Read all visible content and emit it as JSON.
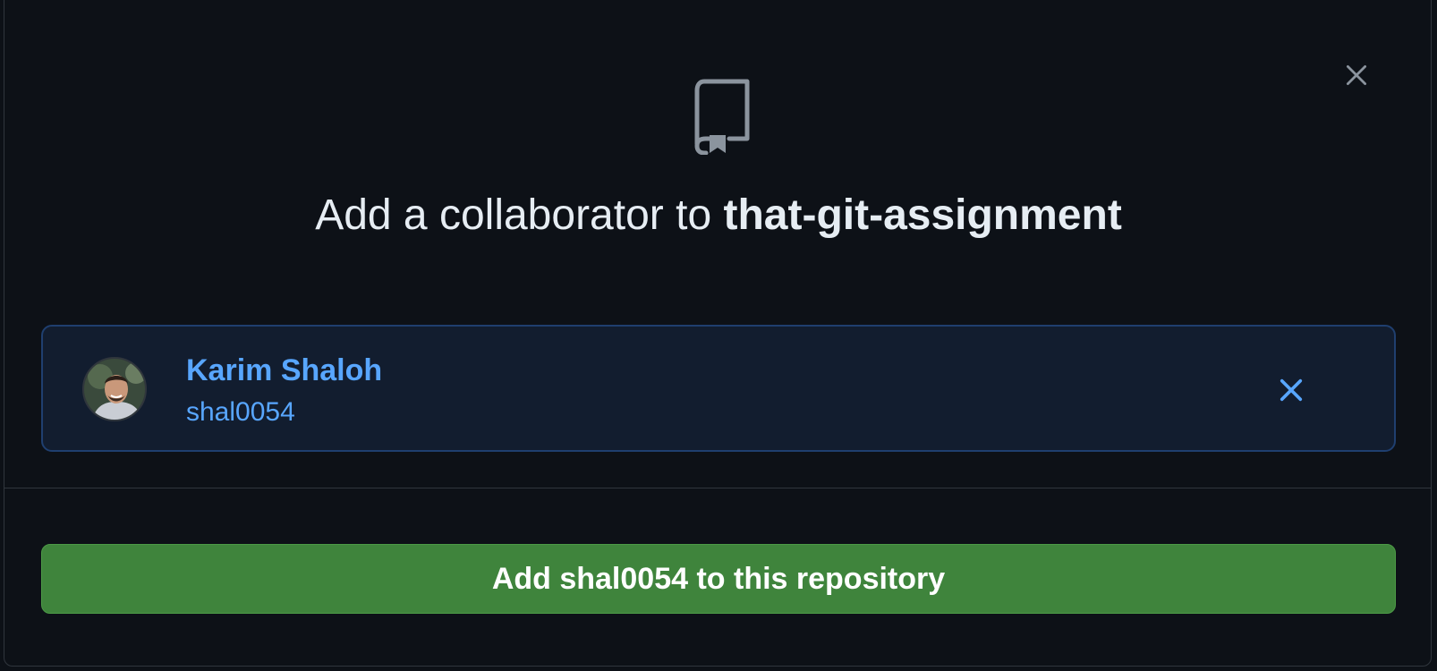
{
  "dialog": {
    "title_prefix": "Add a collaborator to ",
    "repo_name": "that-git-assignment",
    "close_icon": "close-icon",
    "header_icon": "repo-icon"
  },
  "selected_user": {
    "name": "Karim Shaloh",
    "login": "shal0054",
    "avatar_icon": "avatar",
    "remove_icon": "close-icon"
  },
  "action": {
    "add_label": "Add shal0054 to this repository"
  },
  "colors": {
    "background": "#0d1117",
    "border": "#30363d",
    "accent_blue": "#58a6ff",
    "button_green": "#3f843c",
    "selected_bg": "#121d2f",
    "title_text": "#e6edf3",
    "icon_gray": "#8b949e"
  }
}
